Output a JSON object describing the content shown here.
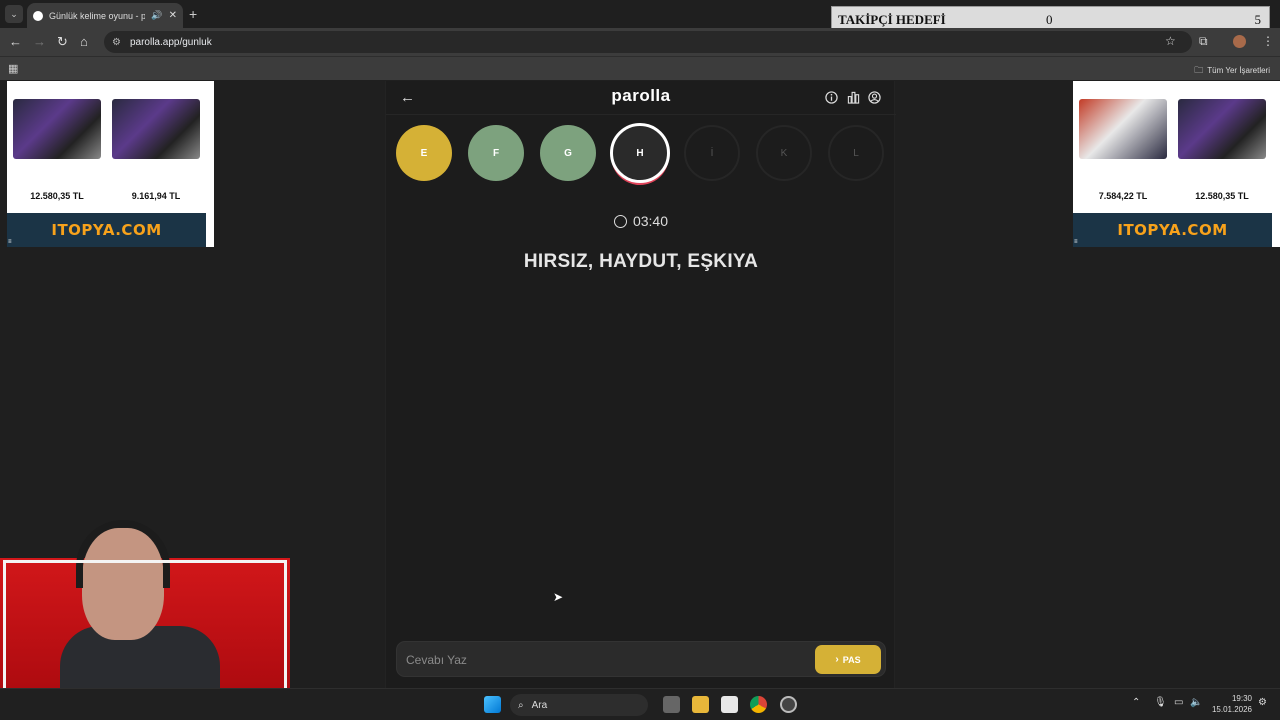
{
  "browser": {
    "tab_title": "Günlük kelime oyunu - parc",
    "url": "parolla.app/gunluk",
    "bookmarks_label": "Tüm Yer İşaretleri"
  },
  "overlay": {
    "label": "TAKİPÇİ HEDEFİ",
    "current": "0",
    "goal": "5"
  },
  "ads": {
    "left": {
      "prices": [
        "12.580,35 TL",
        "9.161,94 TL"
      ],
      "brand": "ITOPYA.COM"
    },
    "right": {
      "prices": [
        "7.584,22 TL",
        "12.580,35 TL"
      ],
      "brand": "ITOPYA.COM"
    }
  },
  "app": {
    "brand": "parolla",
    "letters": [
      {
        "char": "E",
        "state": "yellow"
      },
      {
        "char": "F",
        "state": "green"
      },
      {
        "char": "G",
        "state": "green"
      },
      {
        "char": "H",
        "state": "current"
      },
      {
        "char": "İ",
        "state": "empty"
      },
      {
        "char": "K",
        "state": "empty"
      },
      {
        "char": "L",
        "state": "empty"
      }
    ],
    "timer": "03:40",
    "clue": "HIRSIZ, HAYDUT, EŞKIYA",
    "answer_placeholder": "Cevabı Yaz",
    "pass_label": "PAS"
  },
  "colors": {
    "yellow": "#d5b136",
    "green": "#7da27e",
    "current_ring": "#e0445a"
  },
  "taskbar": {
    "search_label": "Ara",
    "time": "19:30",
    "date": "15.01.2026"
  }
}
